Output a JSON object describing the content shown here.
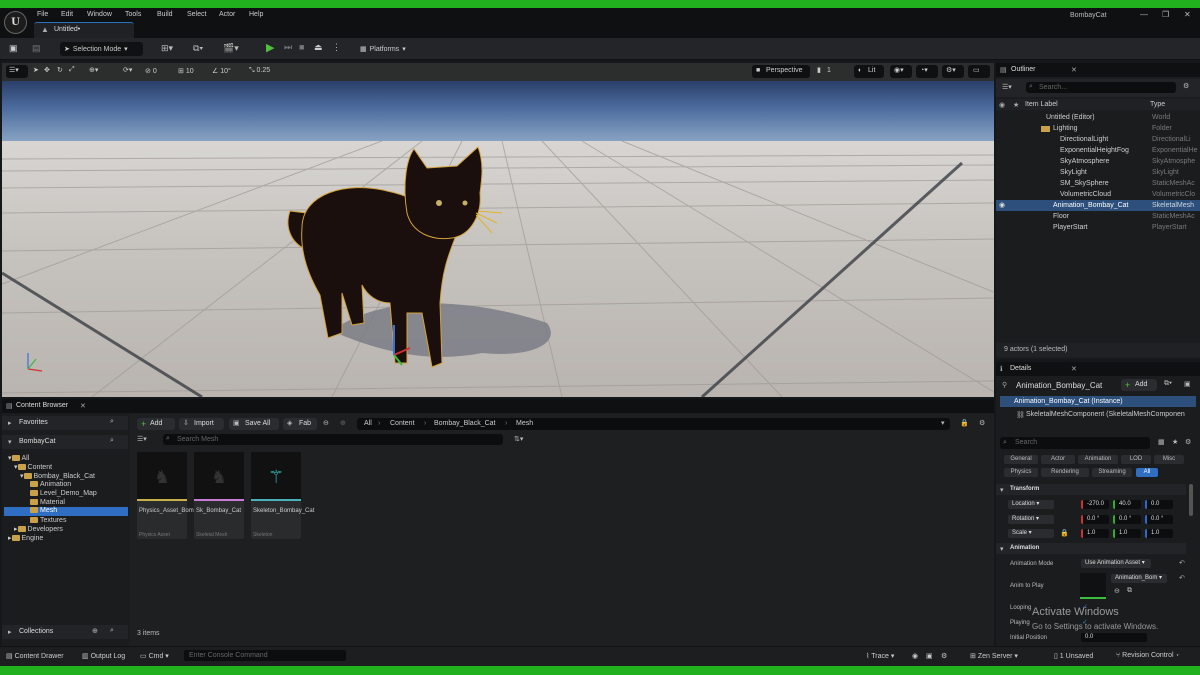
{
  "app": {
    "logo": "U",
    "project_title": "BombayCat",
    "menu": [
      "File",
      "Edit",
      "Window",
      "Tools",
      "Build",
      "Select",
      "Actor",
      "Help"
    ],
    "tab_title": "Untitled•"
  },
  "toolbar": {
    "selection_mode": "Selection Mode",
    "platforms": "Platforms"
  },
  "viewport": {
    "view_mode": "Perspective",
    "camera_speed": "1",
    "lighting": "Lit",
    "snap_rotate": "0",
    "grid_move": "10",
    "rotate_snap": "10°",
    "scale_snap": "0.25",
    "stat_zero": "0"
  },
  "outliner": {
    "title": "Outliner",
    "search_placeholder": "Search...",
    "col_label": "Item Label",
    "col_type": "Type",
    "footer": "9 actors (1 selected)",
    "rows": [
      {
        "name": "Untitled (Editor)",
        "type": "World"
      },
      {
        "name": "Lighting",
        "type": "Folder"
      },
      {
        "name": "DirectionalLight",
        "type": "DirectionalLi"
      },
      {
        "name": "ExponentialHeightFog",
        "type": "ExponentialHe"
      },
      {
        "name": "SkyAtmosphere",
        "type": "SkyAtmosphe"
      },
      {
        "name": "SkyLight",
        "type": "SkyLight"
      },
      {
        "name": "SM_SkySphere",
        "type": "StaticMeshAc"
      },
      {
        "name": "VolumetricCloud",
        "type": "VolumetricClo"
      },
      {
        "name": "Animation_Bombay_Cat",
        "type": "SkeletalMesh"
      },
      {
        "name": "Floor",
        "type": "StaticMeshAc"
      },
      {
        "name": "PlayerStart",
        "type": "PlayerStart"
      }
    ]
  },
  "details": {
    "title": "Details",
    "actor_name": "Animation_Bombay_Cat",
    "add_label": "Add",
    "instance": "Animation_Bombay_Cat (Instance)",
    "component": "SkeletalMeshComponent (SkeletalMeshComponen",
    "search_placeholder": "Search",
    "filters": [
      "General",
      "Actor",
      "Animation",
      "LOD",
      "Misc",
      "Physics",
      "Rendering",
      "Streaming",
      "All"
    ],
    "transform_hdr": "Transform",
    "location_lbl": "Location",
    "rotation_lbl": "Rotation",
    "scale_lbl": "Scale",
    "location": [
      "-270.0",
      "40.0",
      "0.0"
    ],
    "rotation": [
      "0.0 °",
      "0.0 °",
      "0.0 °"
    ],
    "scale": [
      "1.0",
      "1.0",
      "1.0"
    ],
    "animation_hdr": "Animation",
    "anim_mode_lbl": "Animation Mode",
    "anim_mode_val": "Use Animation Asset",
    "anim_to_play_lbl": "Anim to Play",
    "anim_to_play_val": "Animation_Bom",
    "looping_lbl": "Looping",
    "playing_lbl": "Playing",
    "initial_pos_lbl": "Initial Position",
    "initial_pos_val": "0.0"
  },
  "overlay": {
    "activate_title": "Activate Windows",
    "activate_sub": "Go to Settings to activate Windows."
  },
  "content_browser": {
    "title": "Content Browser",
    "add": "Add",
    "import": "Import",
    "save_all": "Save All",
    "fab": "Fab",
    "path": [
      "All",
      "Content",
      "Bombay_Black_Cat",
      "Mesh"
    ],
    "search_placeholder": "Search Mesh",
    "favorites": "Favorites",
    "project": "BombayCat",
    "collections": "Collections",
    "items_count": "3 items",
    "tree": [
      "All",
      "Content",
      "Bombay_Black_Cat",
      "Animation",
      "Level_Demo_Map",
      "Material",
      "Mesh",
      "Textures",
      "Developers",
      "Engine"
    ],
    "assets": [
      {
        "name": "Physics_Asset_Bombay_Cat",
        "type": "Physics Asset",
        "color": "#c8b04a"
      },
      {
        "name": "Sk_Bombay_Cat",
        "type": "Skeletal Mesh",
        "color": "#c77bd3"
      },
      {
        "name": "Skeleton_Bombay_Cat",
        "type": "Skeleton",
        "color": "#4ab0b8"
      }
    ]
  },
  "status": {
    "content_drawer": "Content Drawer",
    "output_log": "Output Log",
    "cmd": "Cmd",
    "console_placeholder": "Enter Console Command",
    "trace": "Trace",
    "zen_server": "Zen Server",
    "unsaved": "1 Unsaved",
    "revision": "Revision Control"
  }
}
